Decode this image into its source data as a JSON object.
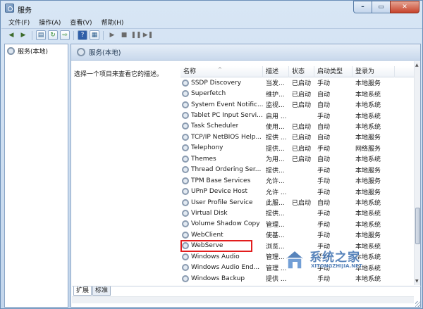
{
  "window": {
    "title": "服务"
  },
  "menu": [
    "文件(F)",
    "操作(A)",
    "查看(V)",
    "帮助(H)"
  ],
  "toolbar": {
    "buttons": [
      "back-icon",
      "forward-icon",
      "show-hide-console-tree-icon",
      "refresh-icon",
      "export-list-icon",
      "help-icon",
      "properties-icon",
      "start-service-icon",
      "stop-service-icon",
      "pause-service-icon",
      "restart-service-icon"
    ]
  },
  "tree": {
    "root_label": "服务(本地)"
  },
  "panel": {
    "header_title": "服务(本地)",
    "description_prompt": "选择一个项目来查看它的描述。"
  },
  "columns": [
    "名称",
    "描述",
    "状态",
    "启动类型",
    "登录为"
  ],
  "services": [
    {
      "name": "SSDP Discovery",
      "desc": "当发...",
      "status": "已启动",
      "start": "手动",
      "logon": "本地服务"
    },
    {
      "name": "Superfetch",
      "desc": "维护...",
      "status": "已启动",
      "start": "自动",
      "logon": "本地系统"
    },
    {
      "name": "System Event Notific...",
      "desc": "监视...",
      "status": "已启动",
      "start": "自动",
      "logon": "本地系统"
    },
    {
      "name": "Tablet PC Input Servi...",
      "desc": "启用 ...",
      "status": "",
      "start": "手动",
      "logon": "本地系统"
    },
    {
      "name": "Task Scheduler",
      "desc": "使用...",
      "status": "已启动",
      "start": "自动",
      "logon": "本地系统"
    },
    {
      "name": "TCP/IP NetBIOS Help...",
      "desc": "提供 ...",
      "status": "已启动",
      "start": "自动",
      "logon": "本地服务"
    },
    {
      "name": "Telephony",
      "desc": "提供...",
      "status": "已启动",
      "start": "手动",
      "logon": "网络服务"
    },
    {
      "name": "Themes",
      "desc": "为用...",
      "status": "已启动",
      "start": "自动",
      "logon": "本地系统"
    },
    {
      "name": "Thread Ordering Ser...",
      "desc": "提供...",
      "status": "",
      "start": "手动",
      "logon": "本地服务"
    },
    {
      "name": "TPM Base Services",
      "desc": "允许...",
      "status": "",
      "start": "手动",
      "logon": "本地服务"
    },
    {
      "name": "UPnP Device Host",
      "desc": "允许 ...",
      "status": "",
      "start": "手动",
      "logon": "本地服务"
    },
    {
      "name": "User Profile Service",
      "desc": "此服...",
      "status": "已启动",
      "start": "自动",
      "logon": "本地系统"
    },
    {
      "name": "Virtual Disk",
      "desc": "提供...",
      "status": "",
      "start": "手动",
      "logon": "本地系统"
    },
    {
      "name": "Volume Shadow Copy",
      "desc": "管理...",
      "status": "",
      "start": "手动",
      "logon": "本地系统"
    },
    {
      "name": "WebClient",
      "desc": "使基...",
      "status": "",
      "start": "手动",
      "logon": "本地服务"
    },
    {
      "name": "WebServe",
      "desc": "浏览...",
      "status": "",
      "start": "手动",
      "logon": "本地系统"
    },
    {
      "name": "Windows Audio",
      "desc": "管理...",
      "status": "",
      "start": "手动",
      "logon": "本地系统"
    },
    {
      "name": "Windows Audio End...",
      "desc": "管理 ...",
      "status": "",
      "start": "手动",
      "logon": "本地系统"
    },
    {
      "name": "Windows Backup",
      "desc": "提供 ...",
      "status": "",
      "start": "手动",
      "logon": "本地系统"
    }
  ],
  "highlighted_service": "User Profile Service",
  "tabs": [
    "扩展",
    "标准"
  ],
  "watermark": {
    "cn": "系统之家",
    "en": "XITONGZHIJIA.NET"
  },
  "colors": {
    "highlight_border": "#e21d1d",
    "pane_header": "#c9d9ec"
  }
}
